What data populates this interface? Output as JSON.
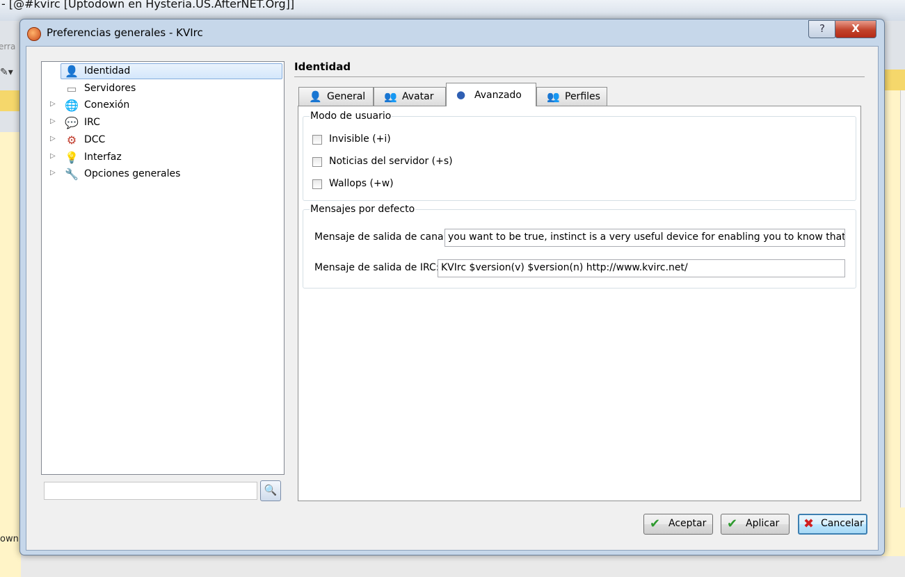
{
  "background": {
    "window_title": "- [@#kvirc [Uptodown en Hysteria.US.AfterNET.Org]]",
    "side_label": "erra",
    "bottom_label": "own"
  },
  "dialog": {
    "title": "Preferencias generales - KVIrc",
    "help_label": "?",
    "close_label": "X"
  },
  "tree": {
    "items": [
      {
        "label": "Identidad",
        "icon": "user-icon",
        "glyph": "👤",
        "expandable": false
      },
      {
        "label": "Servidores",
        "icon": "server-icon",
        "glyph": "▭",
        "expandable": false
      },
      {
        "label": "Conexión",
        "icon": "network-icon",
        "glyph": "🌐",
        "expandable": true
      },
      {
        "label": "IRC",
        "icon": "chat-icon",
        "glyph": "💬",
        "expandable": true
      },
      {
        "label": "DCC",
        "icon": "dcc-icon",
        "glyph": "⚙",
        "expandable": true
      },
      {
        "label": "Interfaz",
        "icon": "lightbulb-icon",
        "glyph": "💡",
        "expandable": true
      },
      {
        "label": "Opciones generales",
        "icon": "wrench-icon",
        "glyph": "🔧",
        "expandable": true
      }
    ],
    "expand_glyph": "▷",
    "search_value": "",
    "search_glyph": "🔍"
  },
  "panel": {
    "title": "Identidad",
    "tabs": [
      {
        "label": "General",
        "icon": "user-icon",
        "glyph": "👤",
        "active": false
      },
      {
        "label": "Avatar",
        "icon": "avatar-icon",
        "glyph": "👥",
        "active": false
      },
      {
        "label": "Avanzado",
        "icon": "advanced-icon",
        "glyph": "●",
        "active": true
      },
      {
        "label": "Perfiles",
        "icon": "profiles-icon",
        "glyph": "👥",
        "active": false
      }
    ],
    "user_mode": {
      "title": "Modo de usuario",
      "options": [
        {
          "label": "Invisible (+i)",
          "checked": false
        },
        {
          "label": "Noticias del servidor (+s)",
          "checked": false
        },
        {
          "label": "Wallops (+w)",
          "checked": false
        }
      ]
    },
    "default_messages": {
      "title": "Mensajes por defecto",
      "channel_part_label": "Mensaje de salida de canal:",
      "channel_part_value": "you want to be true, instinct is a very useful device for enabling you to know that it is",
      "irc_quit_label": "Mensaje de salida de IRC:",
      "irc_quit_value": "KVIrc $version(v) $version(n) http://www.kvirc.net/"
    }
  },
  "buttons": {
    "accept": {
      "label": "Aceptar",
      "glyph": "✔",
      "color": "#2e9a2e"
    },
    "apply": {
      "label": "Aplicar",
      "glyph": "✔",
      "color": "#2e9a2e"
    },
    "cancel": {
      "label": "Cancelar",
      "glyph": "✖",
      "color": "#d12020"
    }
  }
}
